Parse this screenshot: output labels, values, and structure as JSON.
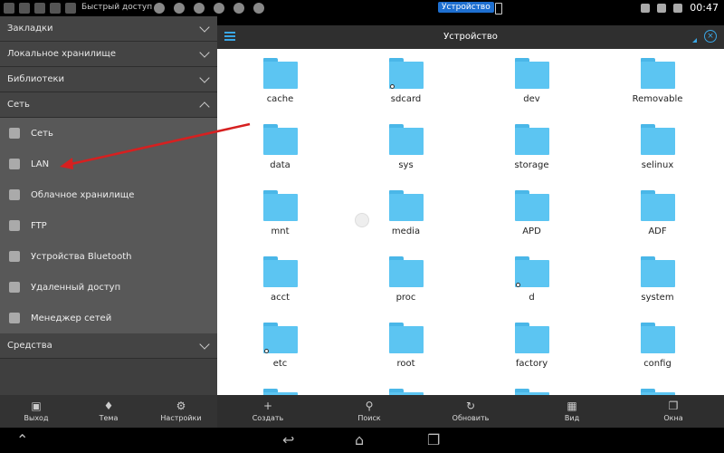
{
  "statusbar": {
    "quick_access": "Быстрый доступ",
    "device_label": "Устройство",
    "time": "00:47"
  },
  "sidebar": {
    "sections": [
      {
        "label": "Закладки",
        "expanded": false
      },
      {
        "label": "Локальное хранилище",
        "expanded": false
      },
      {
        "label": "Библиотеки",
        "expanded": false
      },
      {
        "label": "Сеть",
        "expanded": true
      }
    ],
    "network_items": [
      {
        "label": "Сеть",
        "icon": "network-icon"
      },
      {
        "label": "LAN",
        "icon": "lan-icon"
      },
      {
        "label": "Облачное хранилище",
        "icon": "cloud-icon"
      },
      {
        "label": "FTP",
        "icon": "ftp-icon"
      },
      {
        "label": "Устройства Bluetooth",
        "icon": "bluetooth-icon"
      },
      {
        "label": "Удаленный доступ",
        "icon": "remote-icon"
      },
      {
        "label": "Менеджер сетей",
        "icon": "wifi-icon"
      }
    ],
    "tools_label": "Средства"
  },
  "title": "Устройство",
  "folders": [
    {
      "name": "cache",
      "link": false
    },
    {
      "name": "sdcard",
      "link": true
    },
    {
      "name": "dev",
      "link": false
    },
    {
      "name": "Removable",
      "link": false
    },
    {
      "name": "data",
      "link": false
    },
    {
      "name": "sys",
      "link": false
    },
    {
      "name": "storage",
      "link": false
    },
    {
      "name": "selinux",
      "link": false
    },
    {
      "name": "mnt",
      "link": false
    },
    {
      "name": "media",
      "link": false
    },
    {
      "name": "APD",
      "link": false
    },
    {
      "name": "ADF",
      "link": false
    },
    {
      "name": "acct",
      "link": false
    },
    {
      "name": "proc",
      "link": false
    },
    {
      "name": "d",
      "link": true
    },
    {
      "name": "system",
      "link": false
    },
    {
      "name": "etc",
      "link": true
    },
    {
      "name": "root",
      "link": false
    },
    {
      "name": "factory",
      "link": false
    },
    {
      "name": "config",
      "link": false
    }
  ],
  "bottom_left": [
    {
      "label": "Выход",
      "icon": "exit-icon"
    },
    {
      "label": "Тема",
      "icon": "theme-icon"
    },
    {
      "label": "Настройки",
      "icon": "settings-icon"
    }
  ],
  "bottom_right": [
    {
      "label": "Создать",
      "icon": "plus-icon"
    },
    {
      "label": "Поиск",
      "icon": "search-icon"
    },
    {
      "label": "Обновить",
      "icon": "refresh-icon"
    },
    {
      "label": "Вид",
      "icon": "grid-view-icon"
    },
    {
      "label": "Окна",
      "icon": "windows-icon"
    }
  ],
  "colors": {
    "accent": "#3aa7e6",
    "folder": "#5cc5f2",
    "arrow": "#d62020"
  }
}
